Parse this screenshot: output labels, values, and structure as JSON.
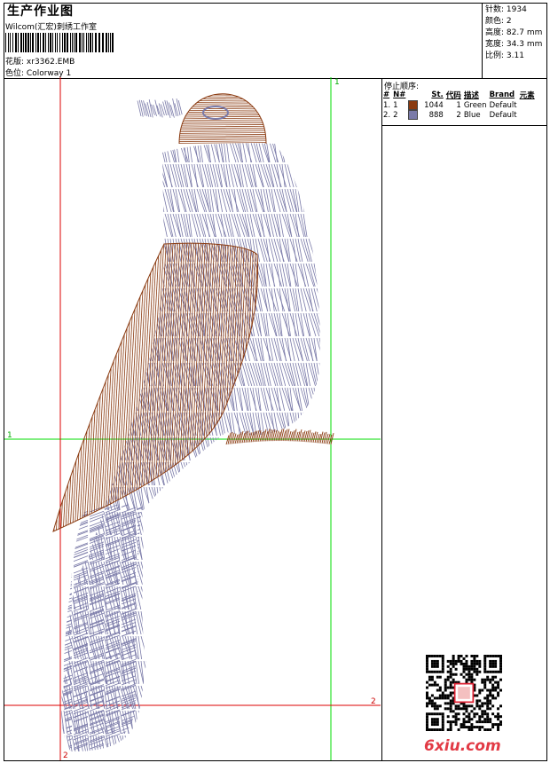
{
  "header": {
    "title": "生产作业图",
    "company": "Wilcom(汇宏)刺绣工作室",
    "pattern_label": "花版:",
    "pattern_file": "xr3362.EMB",
    "colorway_label": "色位:",
    "colorway_name": "Colorway 1"
  },
  "stats": [
    {
      "label": "针数:",
      "value": "1934"
    },
    {
      "label": "颜色:",
      "value": "2"
    },
    {
      "label": "高度:",
      "value": "82.7 mm"
    },
    {
      "label": "宽度:",
      "value": "34.3 mm"
    },
    {
      "label": "比例:",
      "value": "3.11"
    }
  ],
  "stop_sequence": {
    "title": "停止顺序:",
    "headers": [
      "#",
      "N#",
      "St.",
      "代码",
      "描述",
      "Brand",
      "元素"
    ],
    "rows": [
      {
        "index": "1.",
        "n": "1",
        "st": "1044",
        "code": "1",
        "desc": "Green",
        "brand": "Default",
        "color": "#8a3a10"
      },
      {
        "index": "2.",
        "n": "2",
        "st": "888",
        "code": "2",
        "desc": "Blue",
        "brand": "Default",
        "color": "#7a7aa8"
      }
    ]
  },
  "axis_labels": {
    "green_top": "1",
    "green_left": "1",
    "red_right": "2",
    "red_bottom": "2"
  },
  "colors": {
    "thread_brown": "#8a3a10",
    "thread_blue": "#7a7aa8",
    "guide_green": "#00dd00",
    "guide_red": "#dd0000"
  },
  "watermark": {
    "logo": "6xiu.com"
  }
}
